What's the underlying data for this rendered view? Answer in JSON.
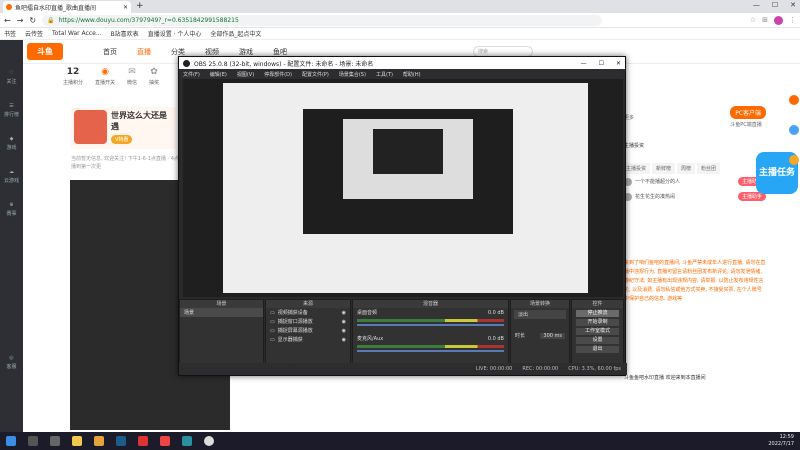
{
  "browser": {
    "tab_title": "鱼吧擂自水印直播_歌曲直播间",
    "url": "https://www.douyu.com/3797949?_r=0.6351842991588215",
    "bookmarks": [
      "书签",
      "云传签",
      "Total War Acce...",
      "B站喜欢表",
      "直播设置 · 个人中心",
      "全部作品_起点中文"
    ]
  },
  "left_nav": {
    "items": [
      "关注",
      "排行榜",
      "游戏",
      "云游戏",
      "赛事"
    ],
    "bottom": "客服"
  },
  "site": {
    "logo": "斗鱼",
    "nav": [
      "首页",
      "直播",
      "分类",
      "视频",
      "游戏",
      "鱼吧"
    ],
    "search_placeholder": "搜索",
    "room_stats": [
      {
        "value": "12",
        "label": "主播积分"
      },
      {
        "value": "",
        "label": "直播开关"
      },
      {
        "value": "",
        "label": "微信"
      },
      {
        "value": "",
        "label": "抽奖"
      }
    ],
    "banner_title": "世界这么大还是遇",
    "banner_pill": "V特惠",
    "description": "当前暂无信息, 欢迎关注! 下午1-6-1点直播 · 4点播到第一次更",
    "right_panel": {
      "more": "更多",
      "pc_button": "PC客户端",
      "pc_sub": "斗鱼PC端直播",
      "tabs": [
        "主播投资",
        "新鲜榜",
        "周榜",
        "粉丝团"
      ],
      "section": "主播投资",
      "rows": [
        {
          "name": "一个不能播超分的人",
          "badge": "主播助手"
        },
        {
          "name": "花生花生的凑热闹",
          "badge": "主播助手"
        }
      ],
      "chat_text": "来到了咱们鱼吧的直播间, 斗鱼严禁未成年人进行直播, 请勿在直播中违规行为, 直播可留言请粉丝团发布新评论, 请勿发泄情绪, 遵纪守法, 如主播有出现违规内容, 请举报. 以防止发布违规性言论, 以及消费, 请勿私信或他方式买卖, 不接受买票, 在个人账号中保护自己的信息, 游戏等",
      "chat_bottom": "斗鱼鱼吧水印直播 欢迎来到本直播间"
    },
    "ad_text": "主播任务"
  },
  "obs": {
    "title": "OBS 25.0.8 (32-bit, windows) - 配置文件: 未命名 - 场景: 未命名",
    "menu": [
      "文件(F)",
      "编辑(E)",
      "视图(V)",
      "停靠部件(D)",
      "配置文件(P)",
      "场景集合(S)",
      "工具(T)",
      "帮助(H)"
    ],
    "docks": {
      "scenes": {
        "header": "场景",
        "items": [
          "场景"
        ]
      },
      "sources": {
        "header": "来源",
        "items": [
          "视频捕获设备",
          "捕捉窗口源播放",
          "捕捉屏幕源播放",
          "显示器捕获"
        ]
      },
      "mixer": {
        "header": "混音器",
        "tracks": [
          {
            "name": "桌面音频",
            "level": "0.0 dB"
          },
          {
            "name": "麦克风/Aux",
            "level": "0.0 dB"
          }
        ]
      },
      "transitions": {
        "header": "场景转换",
        "type": "淡出",
        "duration_label": "时长",
        "duration": "300 ms"
      },
      "controls": {
        "header": "控件",
        "buttons": [
          "停止推流",
          "开始录制",
          "工作室模式",
          "设置",
          "退出"
        ]
      }
    },
    "status": [
      "LIVE: 00:00:00",
      "REC: 00:00:00",
      "CPU: 3.3%, 60.00 fps"
    ]
  },
  "taskbar": {
    "time": "12:59",
    "date": "2022/7/17",
    "icons": [
      "start-icon",
      "search-icon",
      "taskview-icon",
      "explorer-icon",
      "app-icon",
      "steam-icon",
      "netease-icon",
      "chrome-icon",
      "edge-icon",
      "obs-icon"
    ]
  }
}
